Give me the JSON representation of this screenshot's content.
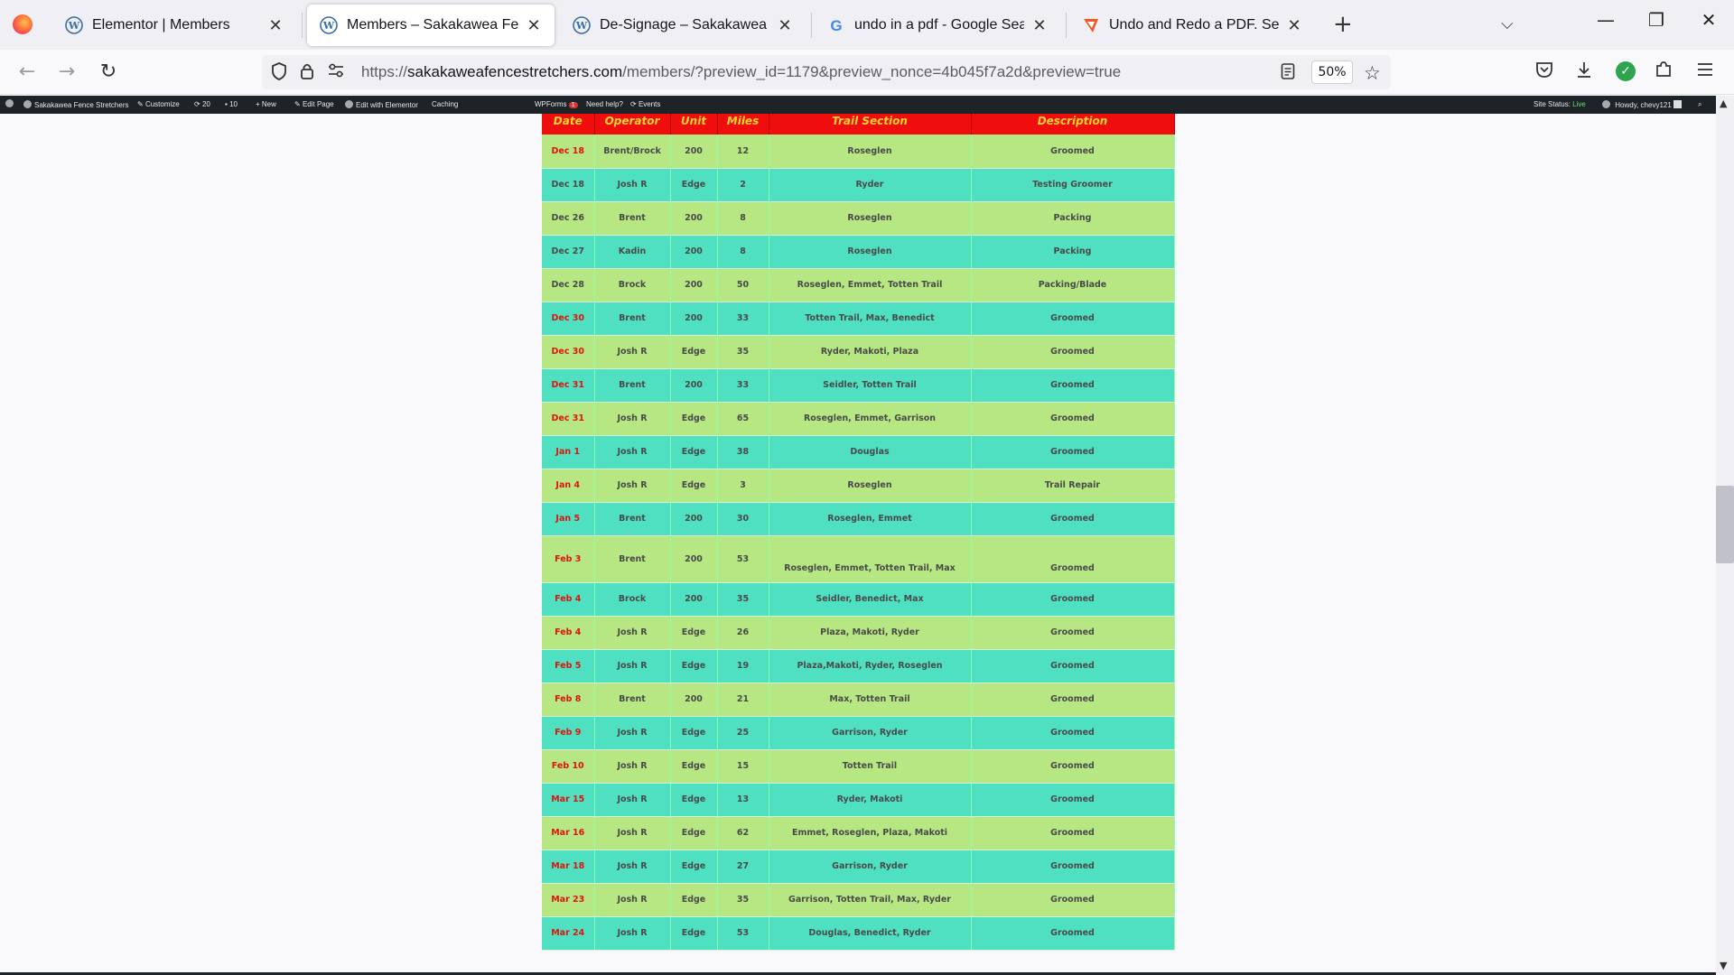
{
  "browser": {
    "tabs": [
      {
        "title": "Elementor | Members",
        "icon": "wordpress-icon",
        "active": false
      },
      {
        "title": "Members – Sakakawea Fence S",
        "icon": "wordpress-icon",
        "active": true
      },
      {
        "title": "De-Signage – Sakakawea Fence",
        "icon": "wordpress-icon",
        "active": false
      },
      {
        "title": "undo in a pdf - Google Search",
        "icon": "google-icon",
        "active": false
      },
      {
        "title": "Undo and Redo a PDF. Search, I",
        "icon": "pdf-app-icon",
        "active": false
      }
    ],
    "url_scheme": "https://",
    "url_host": "sakakaweafencestretchers.com",
    "url_path": "/members/?preview_id=1179&preview_nonce=4b045f7a2d&preview=true",
    "zoom": "50%"
  },
  "adminbar": {
    "site_name": "Sakakawea Fence Stretchers",
    "customize": "Customize",
    "updates": "20",
    "comments": "10",
    "new": "New",
    "edit_page": "Edit Page",
    "edit_elementor": "Edit with Elementor",
    "caching": "Caching",
    "wpforms": "WPForms",
    "wpforms_badge": "1",
    "need_help": "Need help?",
    "events": "Events",
    "site_status_label": "Site Status:",
    "site_status_value": "Live",
    "howdy": "Howdy, chevy121"
  },
  "table": {
    "headers": [
      "Date",
      "Operator",
      "Unit",
      "Miles",
      "Trail Section",
      "Description"
    ],
    "rows": [
      {
        "date": "Dec 18",
        "operator": "Brent/Brock",
        "unit": "200",
        "miles": "12",
        "section": "Roseglen",
        "description": "Groomed",
        "date_red": true
      },
      {
        "date": "Dec 18",
        "operator": "Josh R",
        "unit": "Edge",
        "miles": "2",
        "section": "Ryder",
        "description": "Testing Groomer",
        "date_red": false
      },
      {
        "date": "Dec 26",
        "operator": "Brent",
        "unit": "200",
        "miles": "8",
        "section": "Roseglen",
        "description": "Packing",
        "date_red": false
      },
      {
        "date": "Dec 27",
        "operator": "Kadin",
        "unit": "200",
        "miles": "8",
        "section": "Roseglen",
        "description": "Packing",
        "date_red": false
      },
      {
        "date": "Dec 28",
        "operator": "Brock",
        "unit": "200",
        "miles": "50",
        "section": "Roseglen, Emmet, Totten Trail",
        "description": "Packing/Blade",
        "date_red": false
      },
      {
        "date": "Dec 30",
        "operator": "Brent",
        "unit": "200",
        "miles": "33",
        "section": "Totten Trail, Max, Benedict",
        "description": "Groomed",
        "date_red": true
      },
      {
        "date": "Dec 30",
        "operator": "Josh R",
        "unit": "Edge",
        "miles": "35",
        "section": "Ryder, Makoti, Plaza",
        "description": "Groomed",
        "date_red": true
      },
      {
        "date": "Dec 31",
        "operator": "Brent",
        "unit": "200",
        "miles": "33",
        "section": "Seidler, Totten Trail",
        "description": "Groomed",
        "date_red": true
      },
      {
        "date": "Dec 31",
        "operator": "Josh R",
        "unit": "Edge",
        "miles": "65",
        "section": "Roseglen, Emmet, Garrison",
        "description": "Groomed",
        "date_red": true
      },
      {
        "date": "Jan 1",
        "operator": "Josh R",
        "unit": "Edge",
        "miles": "38",
        "section": "Douglas",
        "description": "Groomed",
        "date_red": true
      },
      {
        "date": "Jan 4",
        "operator": "Josh R",
        "unit": "Edge",
        "miles": "3",
        "section": "Roseglen",
        "description": "Trail Repair",
        "date_red": true
      },
      {
        "date": "Jan 5",
        "operator": "Brent",
        "unit": "200",
        "miles": "30",
        "section": "Roseglen, Emmet",
        "description": "Groomed",
        "date_red": true
      },
      {
        "date": "Feb 3",
        "operator": "Brent",
        "unit": "200",
        "miles": "53",
        "section": "Roseglen, Emmet, Totten Trail, Max",
        "description": "Groomed",
        "date_red": true,
        "tall": true
      },
      {
        "date": "Feb 4",
        "operator": "Brock",
        "unit": "200",
        "miles": "35",
        "section": "Seidler, Benedict, Max",
        "description": "Groomed",
        "date_red": true
      },
      {
        "date": "Feb 4",
        "operator": "Josh R",
        "unit": "Edge",
        "miles": "26",
        "section": "Plaza, Makoti, Ryder",
        "description": "Groomed",
        "date_red": true
      },
      {
        "date": "Feb 5",
        "operator": "Josh R",
        "unit": "Edge",
        "miles": "19",
        "section": "Plaza,Makoti, Ryder, Roseglen",
        "description": "Groomed",
        "date_red": true
      },
      {
        "date": "Feb 8",
        "operator": "Brent",
        "unit": "200",
        "miles": "21",
        "section": "Max, Totten Trail",
        "description": "Groomed",
        "date_red": true
      },
      {
        "date": "Feb 9",
        "operator": "Josh R",
        "unit": "Edge",
        "miles": "25",
        "section": "Garrison, Ryder",
        "description": "Groomed",
        "date_red": true
      },
      {
        "date": "Feb 10",
        "operator": "Josh R",
        "unit": "Edge",
        "miles": "15",
        "section": "Totten Trail",
        "description": "Groomed",
        "date_red": true
      },
      {
        "date": "Mar 15",
        "operator": "Josh R",
        "unit": "Edge",
        "miles": "13",
        "section": "Ryder, Makoti",
        "description": "Groomed",
        "date_red": true
      },
      {
        "date": "Mar 16",
        "operator": "Josh R",
        "unit": "Edge",
        "miles": "62",
        "section": "Emmet, Roseglen, Plaza, Makoti",
        "description": "Groomed",
        "date_red": true
      },
      {
        "date": "Mar 18",
        "operator": "Josh R",
        "unit": "Edge",
        "miles": "27",
        "section": "Garrison, Ryder",
        "description": "Groomed",
        "date_red": true
      },
      {
        "date": "Mar 23",
        "operator": "Josh R",
        "unit": "Edge",
        "miles": "35",
        "section": "Garrison, Totten Trail, Max, Ryder",
        "description": "Groomed",
        "date_red": true
      },
      {
        "date": "Mar 24",
        "operator": "Josh R",
        "unit": "Edge",
        "miles": "53",
        "section": "Douglas, Benedict, Ryder",
        "description": "Groomed",
        "date_red": true
      }
    ]
  },
  "colors": {
    "header_bg": "#f00d0d",
    "header_text": "#ffd42a",
    "row_green": "#b6e782",
    "row_teal": "#4ee0c1",
    "date_red": "#e0140f"
  }
}
